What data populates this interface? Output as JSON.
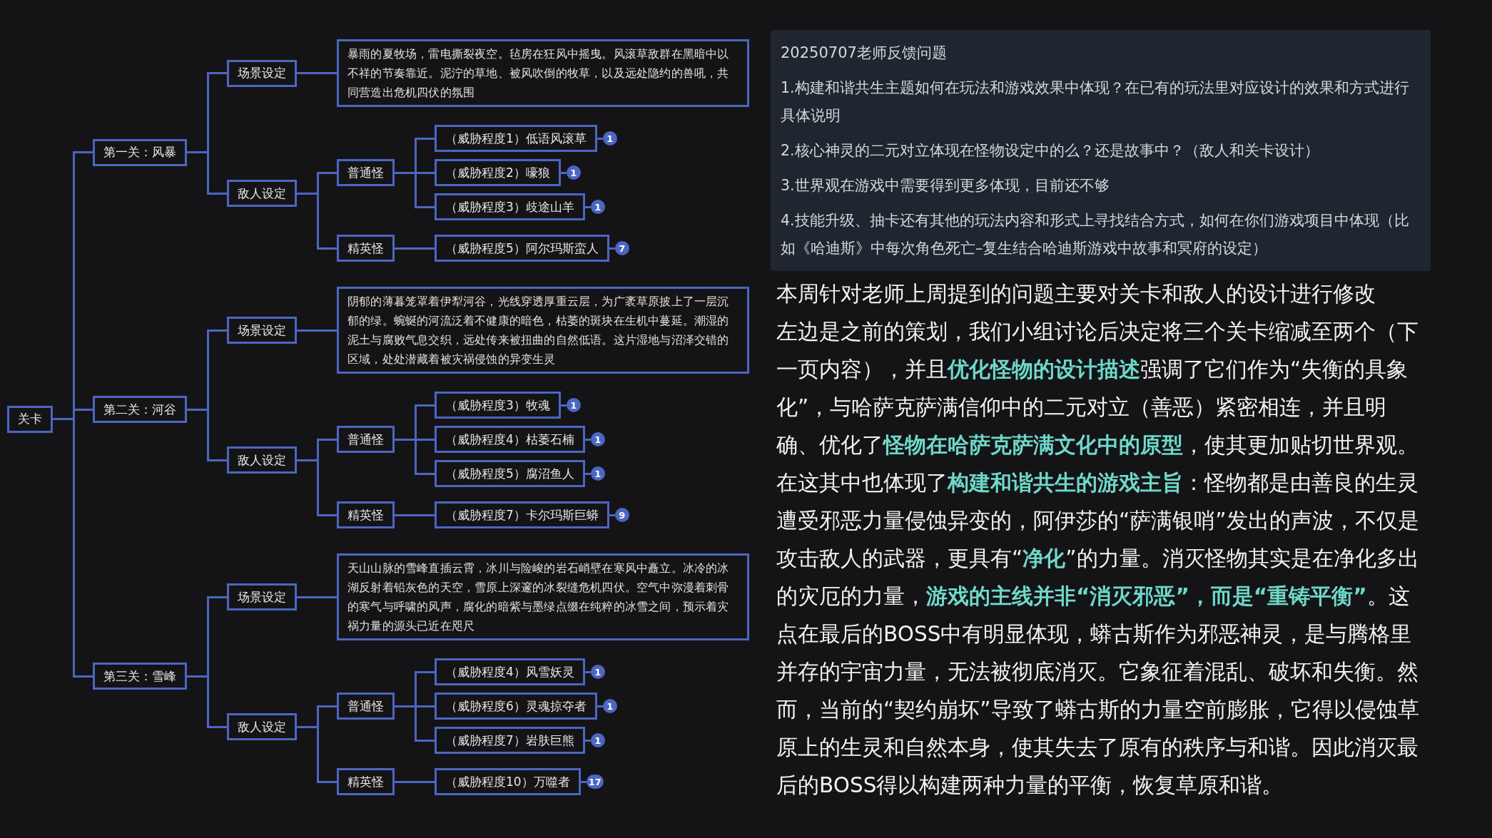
{
  "mindmap": {
    "root": {
      "label": "关卡",
      "children": [
        {
          "label": "第一关：风暴",
          "children": [
            {
              "label": "场景设定",
              "children": [
                {
                  "kind": "note",
                  "label": "暴雨的夏牧场，雷电撕裂夜空。毡房在狂风中摇曳。风滚草敌群在黑暗中以不祥的节奏靠近。泥泞的草地、被风吹倒的牧草，以及远处隐约的兽吼，共同营造出危机四伏的氛围"
                }
              ]
            },
            {
              "label": "敌人设定",
              "children": [
                {
                  "label": "普通怪",
                  "children": [
                    {
                      "label": "（威胁程度1）低语风滚草",
                      "badge": "1"
                    },
                    {
                      "label": "（威胁程度2）嚎狼",
                      "badge": "1"
                    },
                    {
                      "label": "（威胁程度3）歧途山羊",
                      "badge": "1"
                    }
                  ]
                },
                {
                  "label": "精英怪",
                  "children": [
                    {
                      "label": "（威胁程度5）阿尔玛斯蛮人",
                      "badge": "7"
                    }
                  ]
                }
              ]
            }
          ]
        },
        {
          "label": "第二关：河谷",
          "children": [
            {
              "label": "场景设定",
              "children": [
                {
                  "kind": "note",
                  "label": "阴郁的薄暮笼罩着伊犁河谷，光线穿透厚重云层，为广袤草原披上了一层沉郁的绿。蜿蜒的河流泛着不健康的暗色，枯萎的斑块在生机中蔓延。潮湿的泥土与腐败气息交织，远处传来被扭曲的自然低语。这片湿地与沼泽交错的区域，处处潜藏着被灾祸侵蚀的异变生灵"
                }
              ]
            },
            {
              "label": "敌人设定",
              "children": [
                {
                  "label": "普通怪",
                  "children": [
                    {
                      "label": "（威胁程度3）牧魂",
                      "badge": "1"
                    },
                    {
                      "label": "（威胁程度4）枯萎石楠",
                      "badge": "1"
                    },
                    {
                      "label": "（威胁程度5）腐沼鱼人",
                      "badge": "1"
                    }
                  ]
                },
                {
                  "label": "精英怪",
                  "children": [
                    {
                      "label": "（威胁程度7）卡尔玛斯巨蟒",
                      "badge": "9"
                    }
                  ]
                }
              ]
            }
          ]
        },
        {
          "label": "第三关：雪峰",
          "children": [
            {
              "label": "场景设定",
              "children": [
                {
                  "kind": "note",
                  "label": "天山山脉的雪峰直插云霄，冰川与险峻的岩石峭壁在寒风中矗立。冰冷的冰湖反射着铅灰色的天空，雪原上深邃的冰裂缝危机四伏。空气中弥漫着刺骨的寒气与呼啸的风声，腐化的暗紫与墨绿点缀在纯粹的冰雪之间，预示着灾祸力量的源头已近在咫尺"
                }
              ]
            },
            {
              "label": "敌人设定",
              "children": [
                {
                  "label": "普通怪",
                  "children": [
                    {
                      "label": "（威胁程度4）风雪妖灵",
                      "badge": "1"
                    },
                    {
                      "label": "（威胁程度6）灵魂掠夺者",
                      "badge": "1"
                    },
                    {
                      "label": "（威胁程度7）岩肤巨熊",
                      "badge": "1"
                    }
                  ]
                },
                {
                  "label": "精英怪",
                  "children": [
                    {
                      "label": "（威胁程度10）万噬者",
                      "badge": "17"
                    }
                  ]
                }
              ]
            }
          ]
        }
      ]
    }
  },
  "feedback_card": {
    "title": "20250707老师反馈问题",
    "items": [
      "1.构建和谐共生主题如何在玩法和游戏效果中体现？在已有的玩法里对应设计的效果和方式进行具体说明",
      "2.核心神灵的二元对立体现在怪物设定中的么？还是故事中？（敌人和关卡设计）",
      "3.世界观在游戏中需要得到更多体现，目前还不够",
      "4.技能升级、抽卡还有其他的玩法内容和形式上寻找结合方式，如何在你们游戏项目中体现（比如《哈迪斯》中每次角色死亡–复生结合哈迪斯游戏中故事和冥府的设定）"
    ]
  },
  "body": {
    "paragraphs": [
      "本周针对老师上周提到的问题主要对关卡和敌人的设计进行修改",
      "左边是之前的策划，我们小组讨论后决定将三个关卡缩减至两个（下一页内容），并且**优化怪物的设计描述**强调了它们作为“失衡的具象化”，与哈萨克萨满信仰中的二元对立（善恶）紧密相连，并且明确、优化了**怪物在哈萨克萨满文化中的原型**，使其更加贴切世界观。在这其中也体现了**构建和谐共生的游戏主旨**：怪物都是由善良的生灵遭受邪恶力量侵蚀异变的，阿伊莎的“萨满银哨”发出的声波，不仅是攻击敌人的武器，更具有“**净化**”的力量。消灭怪物其实是在净化多出的灾厄的力量，**游戏的主线并非“消灭邪恶”，而是“重铸平衡”**。这点在最后的BOSS中有明显体现，蟒古斯作为邪恶神灵，是与腾格里并存的宇宙力量，无法被彻底消灭。它象征着混乱、破坏和失衡。然而，当前的“契约崩坏”导致了蟒古斯的力量空前膨胀，它得以侵蚀草原上的生灵和自然本身，使其失去了原有的秩序与和谐。因此消灭最后的BOSS得以构建两种力量的平衡，恢复草原和谐。"
    ]
  }
}
